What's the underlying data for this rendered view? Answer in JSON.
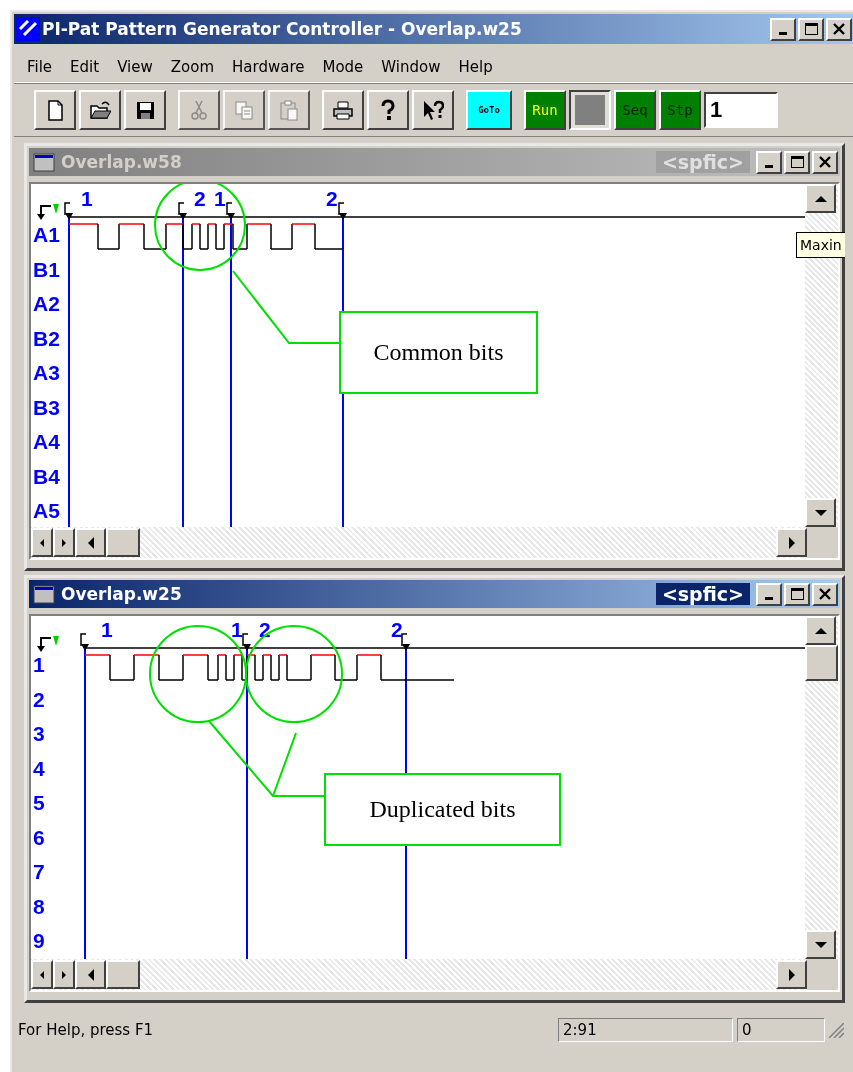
{
  "window": {
    "title": "PI-Pat Pattern Generator Controller - Overlap.w25"
  },
  "menu": [
    {
      "label": "File"
    },
    {
      "label": "Edit"
    },
    {
      "label": "View"
    },
    {
      "label": "Zoom"
    },
    {
      "label": "Hardware"
    },
    {
      "label": "Mode"
    },
    {
      "label": "Window"
    },
    {
      "label": "Help"
    }
  ],
  "toolbar": {
    "groups": [
      [
        {
          "kind": "new",
          "disabled": false,
          "pressed": false
        },
        {
          "kind": "open",
          "disabled": false,
          "pressed": false
        },
        {
          "kind": "save",
          "disabled": false,
          "pressed": false
        }
      ],
      [
        {
          "kind": "cut",
          "disabled": true,
          "pressed": false
        },
        {
          "kind": "copy",
          "disabled": true,
          "pressed": false
        },
        {
          "kind": "paste",
          "disabled": true,
          "pressed": false
        }
      ],
      [
        {
          "kind": "print",
          "disabled": false,
          "pressed": false
        },
        {
          "kind": "help",
          "disabled": false,
          "pressed": false
        },
        {
          "kind": "context-help",
          "disabled": false,
          "pressed": false
        }
      ],
      [
        {
          "kind": "goto",
          "label": "GoTo",
          "disabled": false,
          "pressed": false
        }
      ],
      [
        {
          "kind": "run",
          "label": "Run",
          "disabled": false,
          "pressed": false
        },
        {
          "kind": "blank",
          "disabled": false,
          "pressed": true
        },
        {
          "kind": "seq",
          "label": "Seq",
          "disabled": false,
          "pressed": false
        },
        {
          "kind": "stp",
          "label": "Stp",
          "disabled": false,
          "pressed": false
        },
        {
          "kind": "field",
          "value": "1"
        }
      ]
    ]
  },
  "documents": [
    {
      "title": "Overlap.w58",
      "active": false,
      "tag": "<spfic>",
      "channels": [
        "A1",
        "B1",
        "A2",
        "B2",
        "A3",
        "B3",
        "A4",
        "B4",
        "A5"
      ],
      "markers": [
        {
          "label": "1"
        },
        {
          "label": "2"
        },
        {
          "label": "1"
        },
        {
          "label": "2"
        }
      ],
      "callout": "Common bits",
      "tooltip": "Maxin"
    },
    {
      "title": "Overlap.w25",
      "active": true,
      "tag": "<spfic>",
      "channels": [
        "1",
        "2",
        "3",
        "4",
        "5",
        "6",
        "7",
        "8",
        "9"
      ],
      "markers": [
        {
          "label": "1"
        },
        {
          "label": "1"
        },
        {
          "label": "2"
        },
        {
          "label": "2"
        }
      ],
      "callout": "Duplicated bits"
    }
  ],
  "status_bar": {
    "message": "For Help, press F1",
    "position": "2:91",
    "value": "0"
  }
}
